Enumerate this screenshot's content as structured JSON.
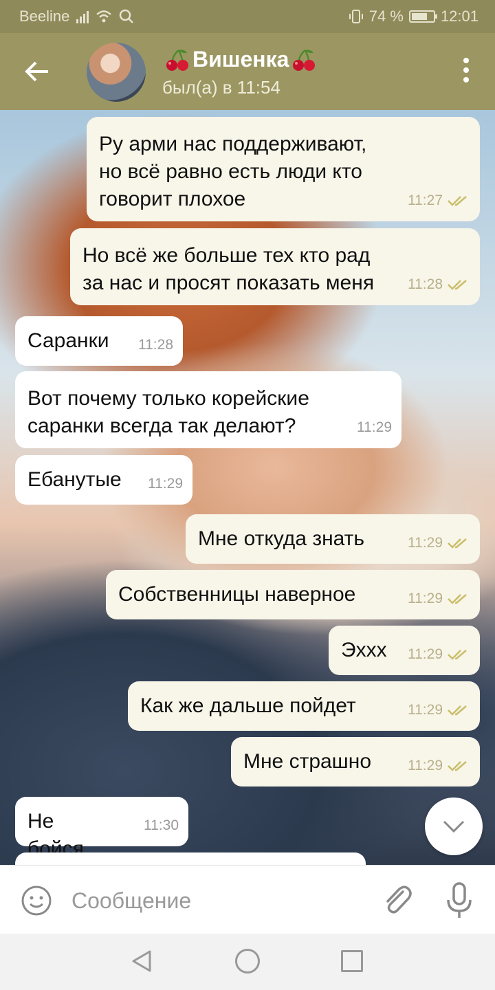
{
  "status_bar": {
    "carrier": "Beeline",
    "battery": "74 %",
    "battery_level": 0.74,
    "time": "12:01"
  },
  "header": {
    "contact_name": "Вишенка",
    "last_seen": "был(а) в 11:54"
  },
  "messages": [
    {
      "direction": "out",
      "text": "Ру арми нас поддерживают, но всё равно есть люди кто говорит плохое",
      "time": "11:27",
      "read": true
    },
    {
      "direction": "out",
      "text": "Но всё же больше тех кто рад за нас и просят показать меня",
      "time": "11:28",
      "read": true
    },
    {
      "direction": "in",
      "text": "Саранки",
      "time": "11:28"
    },
    {
      "direction": "in",
      "text": "Вот почему только корейские саранки всегда так делают?",
      "time": "11:29"
    },
    {
      "direction": "in",
      "text": "Ебанутые",
      "time": "11:29"
    },
    {
      "direction": "out",
      "text": "Мне откуда знать",
      "time": "11:29",
      "read": true
    },
    {
      "direction": "out",
      "text": "Собственницы наверное",
      "time": "11:29",
      "read": true
    },
    {
      "direction": "out",
      "text": "Эххх",
      "time": "11:29",
      "read": true
    },
    {
      "direction": "out",
      "text": "Как же дальше пойдет",
      "time": "11:29",
      "read": true
    },
    {
      "direction": "out",
      "text": "Мне страшно",
      "time": "11:29",
      "read": true
    },
    {
      "direction": "in",
      "text": "Не бойся",
      "time": "11:30"
    }
  ],
  "input": {
    "placeholder": "Сообщение"
  },
  "icons": {
    "back": "arrow-left-icon",
    "menu": "more-vertical-icon",
    "emoji": "smiley-icon",
    "attach": "paperclip-icon",
    "mic": "microphone-icon",
    "scroll": "chevron-down-icon"
  },
  "colors": {
    "header": "#9c9762",
    "status_bar": "#8f8a5a",
    "outgoing_bubble": "#f8f5e9",
    "incoming_bubble": "#ffffff",
    "read_check": "#c9be6a"
  }
}
